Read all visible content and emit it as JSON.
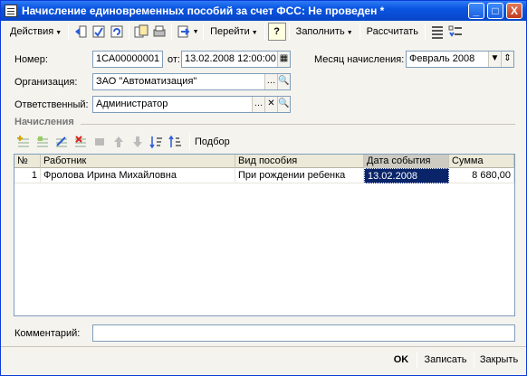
{
  "window": {
    "title": "Начисление единовременных пособий за счет ФСС: Не проведен *",
    "buttons": {
      "minimize": "_",
      "maximize": "□",
      "close": "X"
    }
  },
  "toolbar": {
    "actions": "Действия",
    "goto": "Перейти",
    "help": "?",
    "fill": "Заполнить",
    "calculate": "Рассчитать"
  },
  "form": {
    "number_label": "Номер:",
    "number_value": "1СА00000001",
    "from_label": "от:",
    "date_value": "13.02.2008 12:00:00",
    "month_label": "Месяц начисления:",
    "month_value": "Февраль 2008",
    "org_label": "Организация:",
    "org_value": "ЗАО \"Автоматизация\"",
    "resp_label": "Ответственный:",
    "resp_value": "Администратор",
    "comment_label": "Комментарий:",
    "comment_value": ""
  },
  "section": {
    "title": "Начисления"
  },
  "grid_toolbar": {
    "pick": "Подбор"
  },
  "table": {
    "headers": [
      "№",
      "Работник",
      "Вид пособия",
      "Дата события",
      "Сумма"
    ],
    "rows": [
      {
        "n": "1",
        "worker": "Фролова Ирина Михайловна",
        "type": "При рождении ребенка",
        "date": "13.02.2008",
        "sum": "8 680,00"
      }
    ]
  },
  "footer": {
    "ok": "OK",
    "save": "Записать",
    "close": "Закрыть"
  }
}
